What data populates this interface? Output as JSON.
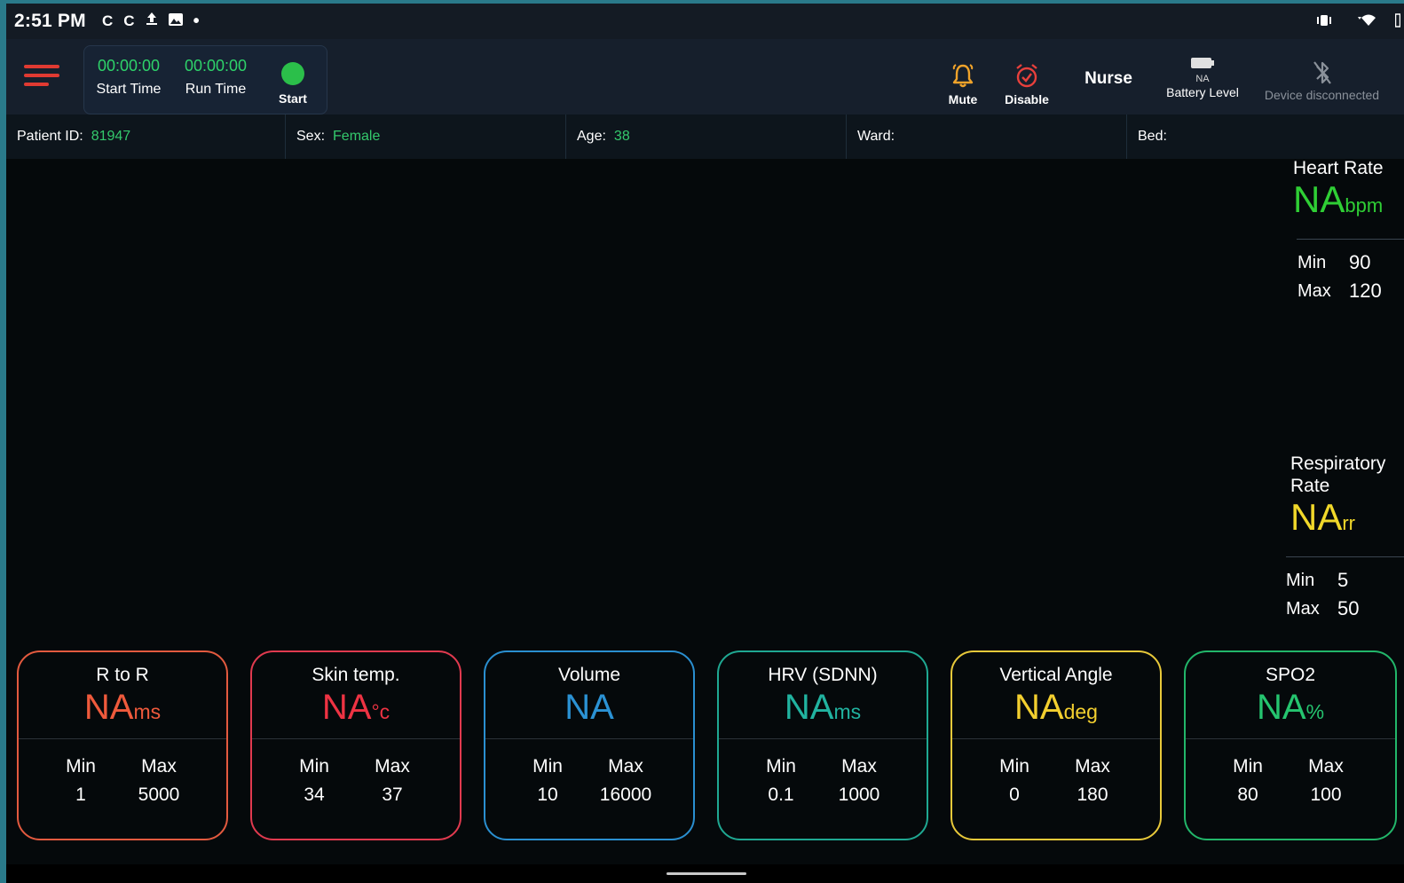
{
  "status_bar": {
    "time": "2:51 PM",
    "notification_icons": [
      "c-app-icon",
      "c-app-icon",
      "upload-icon",
      "image-icon"
    ]
  },
  "toolbar": {
    "start_time_value": "00:00:00",
    "start_time_label": "Start Time",
    "run_time_value": "00:00:00",
    "run_time_label": "Run Time",
    "start_label": "Start",
    "mute_label": "Mute",
    "disable_label": "Disable",
    "role": "Nurse",
    "battery_value": "NA",
    "battery_label": "Battery Level",
    "device_status": "Device disconnected",
    "colors": {
      "accent_green": "#2ed36a",
      "menu_red": "#e03a32",
      "bell_orange": "#f0a32a",
      "alarm_red": "#e8403c"
    }
  },
  "patient": {
    "id_label": "Patient ID:",
    "id_value": "81947",
    "sex_label": "Sex:",
    "sex_value": "Female",
    "age_label": "Age:",
    "age_value": "38",
    "ward_label": "Ward:",
    "ward_value": "",
    "bed_label": "Bed:",
    "bed_value": ""
  },
  "side_vitals": {
    "heart_rate": {
      "title": "Heart Rate",
      "value": "NA",
      "unit": "bpm",
      "min_label": "Min",
      "min": "90",
      "max_label": "Max",
      "max": "120",
      "color": "#2fce35"
    },
    "respiratory_rate": {
      "title_line1": "Respiratory",
      "title_line2": "Rate",
      "value": "NA",
      "unit": "rr",
      "min_label": "Min",
      "min": "5",
      "max_label": "Max",
      "max": "50",
      "color": "#f1d82a"
    }
  },
  "cards": {
    "r_to_r": {
      "title": "R to R",
      "value": "NA",
      "unit": "ms",
      "min_label": "Min",
      "min": "1",
      "max_label": "Max",
      "max": "5000",
      "color": "#ef5a3c"
    },
    "skin_temp": {
      "title": "Skin temp.",
      "value": "NA",
      "unit": "°c",
      "min_label": "Min",
      "min": "34",
      "max_label": "Max",
      "max": "37",
      "color": "#ee3343"
    },
    "volume": {
      "title": "Volume",
      "value": "NA",
      "unit": "",
      "min_label": "Min",
      "min": "10",
      "max_label": "Max",
      "max": "16000",
      "color": "#2b92d4"
    },
    "hrv": {
      "title": "HRV (SDNN)",
      "value": "NA",
      "unit": "ms",
      "min_label": "Min",
      "min": "0.1",
      "max_label": "Max",
      "max": "1000",
      "color": "#21b3a0"
    },
    "vertical_angle": {
      "title": "Vertical Angle",
      "value": "NA",
      "unit": "deg",
      "min_label": "Min",
      "min": "0",
      "max_label": "Max",
      "max": "180",
      "color": "#f3cf2f"
    },
    "spo2": {
      "title": "SPO2",
      "value": "NA",
      "unit": "%",
      "min_label": "Min",
      "min": "80",
      "max_label": "Max",
      "max": "100",
      "color": "#25c46f"
    }
  }
}
